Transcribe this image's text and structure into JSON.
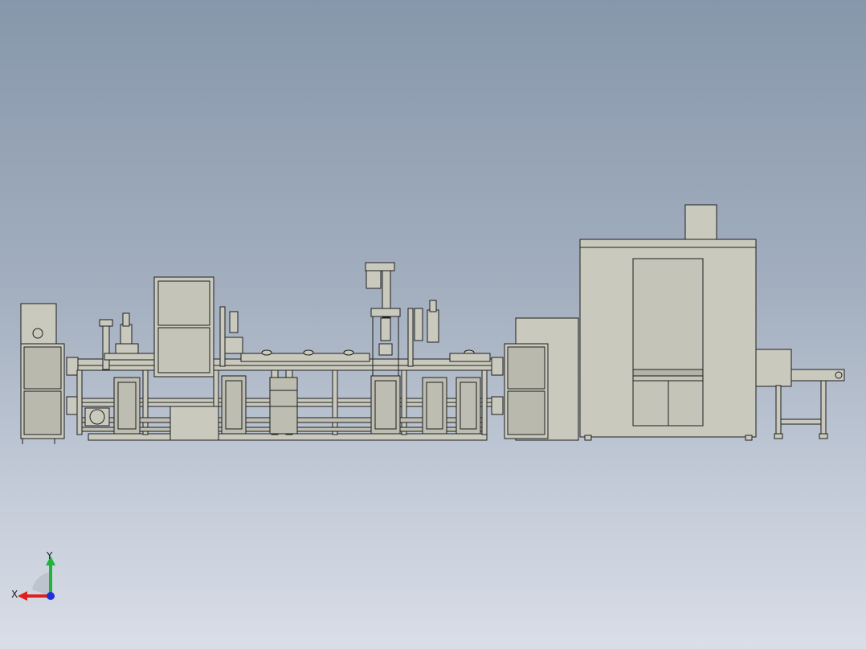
{
  "window": {
    "title": ""
  },
  "model": {
    "description_visible": false,
    "fill_color": "#c9c9bd",
    "edge_color": "#1e1e1e"
  },
  "triad": {
    "x_label": "X",
    "y_label": "Y",
    "x_color": "#e0201c",
    "y_color": "#22b43a",
    "z_color": "#2030d8"
  }
}
